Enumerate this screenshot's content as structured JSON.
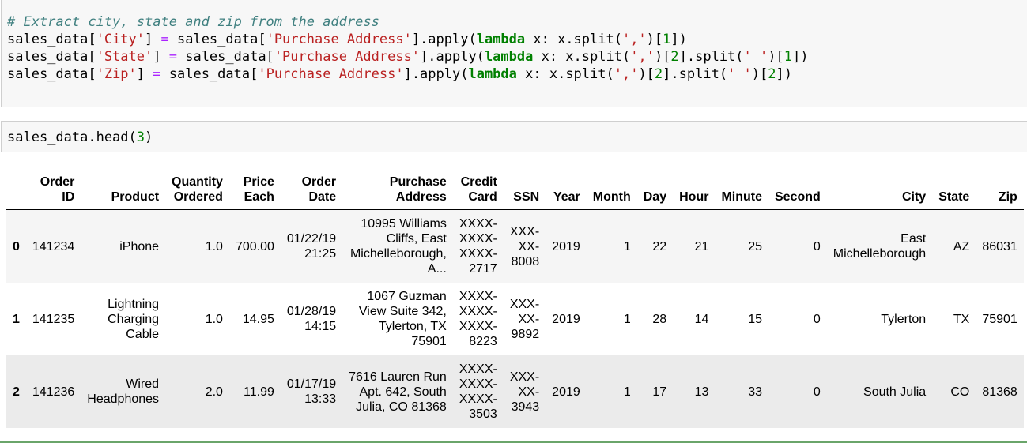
{
  "cells": [
    {
      "lines": [
        [
          [
            "c-com",
            "# Extract city, state and zip from the address"
          ]
        ],
        [
          [
            "",
            "sales_data["
          ],
          [
            "c-str",
            "'City'"
          ],
          [
            "",
            "] "
          ],
          [
            "c-op",
            "="
          ],
          [
            "",
            " sales_data["
          ],
          [
            "c-str",
            "'Purchase Address'"
          ],
          [
            "",
            "].apply("
          ],
          [
            "c-kw",
            "lambda"
          ],
          [
            "",
            " x: x.split("
          ],
          [
            "c-str",
            "','"
          ],
          [
            "",
            ")["
          ],
          [
            "c-num",
            "1"
          ],
          [
            "",
            "])"
          ]
        ],
        [
          [
            "",
            "sales_data["
          ],
          [
            "c-str",
            "'State'"
          ],
          [
            "",
            "] "
          ],
          [
            "c-op",
            "="
          ],
          [
            "",
            " sales_data["
          ],
          [
            "c-str",
            "'Purchase Address'"
          ],
          [
            "",
            "].apply("
          ],
          [
            "c-kw",
            "lambda"
          ],
          [
            "",
            " x: x.split("
          ],
          [
            "c-str",
            "','"
          ],
          [
            "",
            ")["
          ],
          [
            "c-num",
            "2"
          ],
          [
            "",
            "].split("
          ],
          [
            "c-str",
            "' '"
          ],
          [
            "",
            ")["
          ],
          [
            "c-num",
            "1"
          ],
          [
            "",
            "])"
          ]
        ],
        [
          [
            "",
            "sales_data["
          ],
          [
            "c-str",
            "'Zip'"
          ],
          [
            "",
            "] "
          ],
          [
            "c-op",
            "="
          ],
          [
            "",
            " sales_data["
          ],
          [
            "c-str",
            "'Purchase Address'"
          ],
          [
            "",
            "].apply("
          ],
          [
            "c-kw",
            "lambda"
          ],
          [
            "",
            " x: x.split("
          ],
          [
            "c-str",
            "','"
          ],
          [
            "",
            ")["
          ],
          [
            "c-num",
            "2"
          ],
          [
            "",
            "].split("
          ],
          [
            "c-str",
            "' '"
          ],
          [
            "",
            ")["
          ],
          [
            "c-num",
            "2"
          ],
          [
            "",
            "])"
          ]
        ]
      ]
    },
    {
      "lines": [
        [
          [
            "",
            "sales_data.head("
          ],
          [
            "c-num",
            "3"
          ],
          [
            "",
            ")"
          ]
        ]
      ]
    }
  ],
  "table": {
    "headers": [
      [
        "",
        ""
      ],
      [
        "Order",
        "ID"
      ],
      [
        "",
        "Product"
      ],
      [
        "Quantity",
        "Ordered"
      ],
      [
        "Price",
        "Each"
      ],
      [
        "Order",
        "Date"
      ],
      [
        "Purchase",
        "Address"
      ],
      [
        "Credit",
        "Card"
      ],
      [
        "",
        "SSN"
      ],
      [
        "",
        "Year"
      ],
      [
        "",
        "Month"
      ],
      [
        "",
        "Day"
      ],
      [
        "",
        "Hour"
      ],
      [
        "",
        "Minute"
      ],
      [
        "",
        "Second"
      ],
      [
        "",
        "City"
      ],
      [
        "",
        "State"
      ],
      [
        "",
        "Zip"
      ]
    ],
    "rows": [
      [
        [
          "0"
        ],
        [
          "141234"
        ],
        [
          "iPhone"
        ],
        [
          "1.0"
        ],
        [
          "700.00"
        ],
        [
          "01/22/19",
          "21:25"
        ],
        [
          "10995 Williams",
          "Cliffs, East",
          "Michelleborough,",
          "A..."
        ],
        [
          "XXXX-",
          "XXXX-",
          "XXXX-",
          "2717"
        ],
        [
          "XXX-",
          "XX-",
          "8008"
        ],
        [
          "2019"
        ],
        [
          "1"
        ],
        [
          "22"
        ],
        [
          "21"
        ],
        [
          "25"
        ],
        [
          "0"
        ],
        [
          "East",
          "Michelleborough"
        ],
        [
          "AZ"
        ],
        [
          "86031"
        ]
      ],
      [
        [
          "1"
        ],
        [
          "141235"
        ],
        [
          "Lightning",
          "Charging",
          "Cable"
        ],
        [
          "1.0"
        ],
        [
          "14.95"
        ],
        [
          "01/28/19",
          "14:15"
        ],
        [
          "1067 Guzman",
          "View Suite 342,",
          "Tylerton, TX",
          "75901"
        ],
        [
          "XXXX-",
          "XXXX-",
          "XXXX-",
          "8223"
        ],
        [
          "XXX-",
          "XX-",
          "9892"
        ],
        [
          "2019"
        ],
        [
          "1"
        ],
        [
          "28"
        ],
        [
          "14"
        ],
        [
          "15"
        ],
        [
          "0"
        ],
        [
          "Tylerton"
        ],
        [
          "TX"
        ],
        [
          "75901"
        ]
      ],
      [
        [
          "2"
        ],
        [
          "141236"
        ],
        [
          "Wired",
          "Headphones"
        ],
        [
          "2.0"
        ],
        [
          "11.99"
        ],
        [
          "01/17/19",
          "13:33"
        ],
        [
          "7616 Lauren Run",
          "Apt. 642, South",
          "Julia, CO 81368"
        ],
        [
          "XXXX-",
          "XXXX-",
          "XXXX-",
          "3503"
        ],
        [
          "XXX-",
          "XX-",
          "3943"
        ],
        [
          "2019"
        ],
        [
          "1"
        ],
        [
          "17"
        ],
        [
          "13"
        ],
        [
          "33"
        ],
        [
          "0"
        ],
        [
          "South Julia"
        ],
        [
          "CO"
        ],
        [
          "81368"
        ]
      ]
    ]
  }
}
